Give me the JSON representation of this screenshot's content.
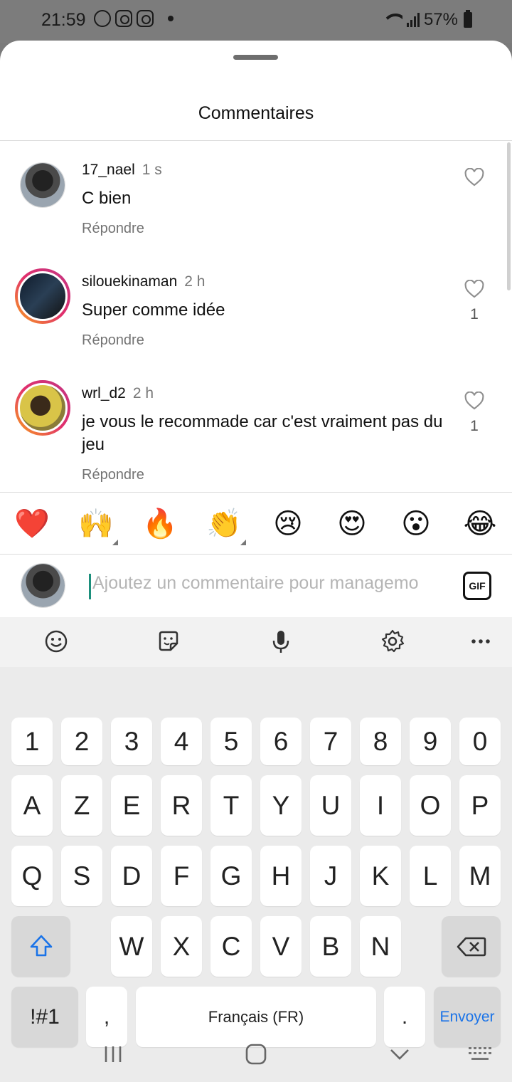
{
  "status_bar": {
    "time": "21:59",
    "battery": "57%"
  },
  "sheet": {
    "title": "Commentaires"
  },
  "comments": [
    {
      "user": "17_nael",
      "time": "1 s",
      "text": "C bien",
      "reply": "Répondre",
      "likes": ""
    },
    {
      "user": "silouekinaman",
      "time": "2 h",
      "text": "Super comme idée",
      "reply": "Répondre",
      "likes": "1"
    },
    {
      "user": "wrl_d2",
      "time": "2 h",
      "text": "je vous le recommade car c'est vraiment pas du jeu",
      "reply": "Répondre",
      "likes": "1"
    }
  ],
  "quick_emojis": [
    "❤️",
    "🙌",
    "🔥",
    "👏",
    "😢",
    "😍",
    "😮",
    "😂"
  ],
  "composer": {
    "placeholder": "Ajoutez un commentaire pour managemo",
    "gif_label": "GIF"
  },
  "keyboard": {
    "row_numbers": [
      "1",
      "2",
      "3",
      "4",
      "5",
      "6",
      "7",
      "8",
      "9",
      "0"
    ],
    "row1": [
      "A",
      "Z",
      "E",
      "R",
      "T",
      "Y",
      "U",
      "I",
      "O",
      "P"
    ],
    "row2": [
      "Q",
      "S",
      "D",
      "F",
      "G",
      "H",
      "J",
      "K",
      "L",
      "M"
    ],
    "row3": [
      "W",
      "X",
      "C",
      "V",
      "B",
      "N"
    ],
    "symbols_label": "!#1",
    "comma_label": ",",
    "space_label": "Français (FR)",
    "period_label": ".",
    "send_label": "Envoyer"
  }
}
